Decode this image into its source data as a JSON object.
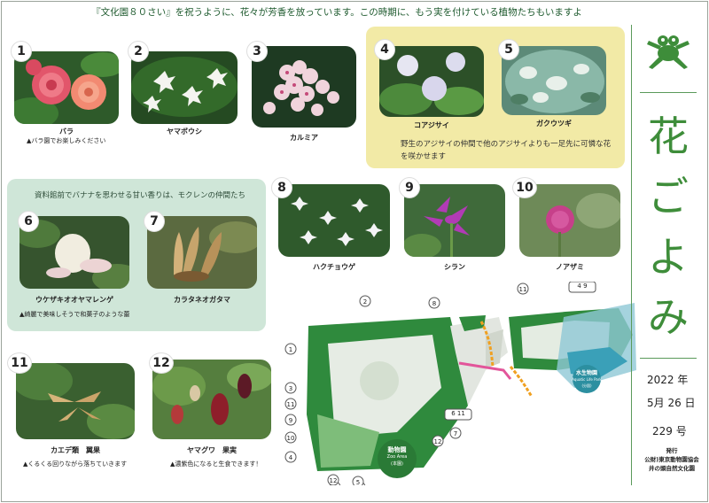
{
  "header": {
    "intro": "『文化園８０さい』を祝うように、花々が芳香を放っています。この時期に、もう実を付けている植物たちもいますよ"
  },
  "sidebar": {
    "title_chars": [
      "花",
      "ご",
      "よ",
      "み"
    ],
    "date_year": "2022 年",
    "date_day": "5月 26 日",
    "issue": "229 号",
    "publisher_label": "発行",
    "publisher_org": "公財)東京動物園協会",
    "publisher_place": "井の頭自然文化園"
  },
  "plants": [
    {
      "no": "1",
      "name": "バラ",
      "note": "▲バラ園でお楽しみください"
    },
    {
      "no": "2",
      "name": "ヤマボウシ"
    },
    {
      "no": "3",
      "name": "カルミア"
    },
    {
      "no": "4",
      "name": "コアジサイ"
    },
    {
      "no": "5",
      "name": "ガクウツギ"
    },
    {
      "no": "6",
      "name": "ウケザキオオヤマレンゲ",
      "note": "▲綺麗で美味しそうで和菓子のような蕾"
    },
    {
      "no": "7",
      "name": "カラタネオガタマ"
    },
    {
      "no": "8",
      "name": "ハクチョウゲ"
    },
    {
      "no": "9",
      "name": "シラン"
    },
    {
      "no": "10",
      "name": "ノアザミ"
    },
    {
      "no": "11",
      "name": "カエデ類　翼果",
      "note": "▲くるくる回りながら落ちていきます"
    },
    {
      "no": "12",
      "name": "ヤマグワ　果実",
      "note": "▲濃紫色になると生食できます！"
    }
  ],
  "hydrangea_note": "野生のアジサイの仲間で他のアジサイよりも一足先に可憐な花を咲かせます",
  "magnolia_header": "資料館前でバナナを思わせる甘い香りは、モクレンの仲間たち",
  "map": {
    "zoo_label": "動物園",
    "zoo_sub": "Zoo Area",
    "zoo_sub2": "(本園)",
    "aquatic_label": "水生物園",
    "aquatic_sub": "Aquatic Life Park",
    "aquatic_sub2": "(分園)",
    "markers": [
      "1",
      "2",
      "3",
      "4",
      "5",
      "6",
      "7",
      "8",
      "9",
      "10",
      "11",
      "12"
    ],
    "marker_6_11": "6 11",
    "marker_4_9": "4 9"
  },
  "colors": {
    "accent_green": "#3e8d3a",
    "yellow_box": "#f2eaa6",
    "green_box": "#cfe6d8",
    "map_green": "#2f8a3d"
  }
}
